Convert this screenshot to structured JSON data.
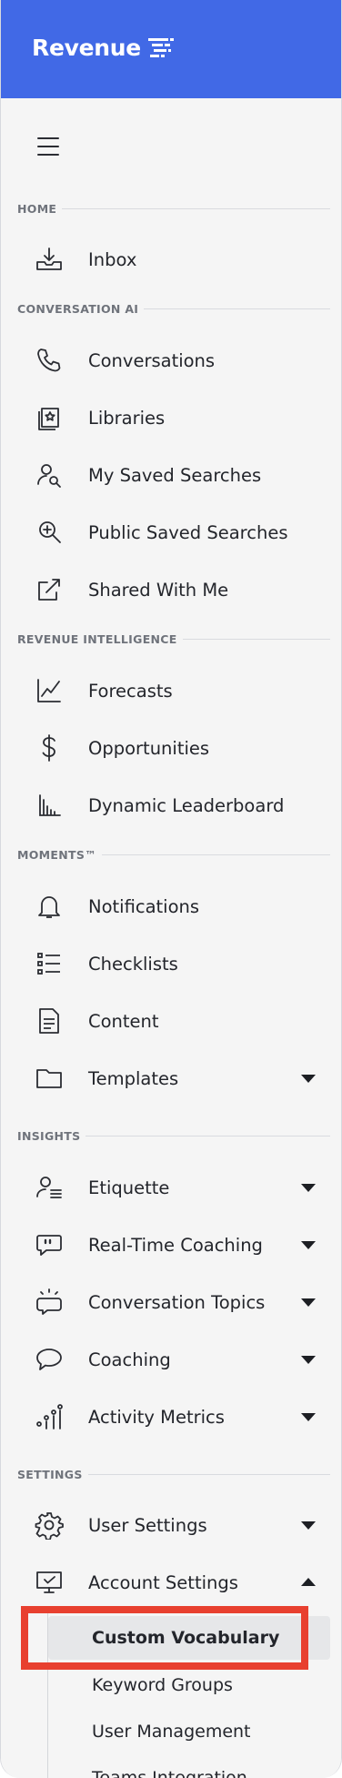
{
  "brand": {
    "name": "Revenue",
    "header_color": "#4169e6",
    "highlight_color": "#e8402f"
  },
  "menu_toggle": {
    "icon": "hamburger-icon"
  },
  "sections": {
    "home": "HOME",
    "conversation_ai": "CONVERSATION AI",
    "revenue_intelligence": "REVENUE INTELLIGENCE",
    "moments": "MOMENTS™",
    "insights": "INSIGHTS",
    "settings": "SETTINGS"
  },
  "items": {
    "inbox": "Inbox",
    "conversations": "Conversations",
    "libraries": "Libraries",
    "my_saved_searches": "My Saved Searches",
    "public_saved_searches": "Public Saved Searches",
    "shared_with_me": "Shared With Me",
    "forecasts": "Forecasts",
    "opportunities": "Opportunities",
    "dynamic_leaderboard": "Dynamic Leaderboard",
    "notifications": "Notifications",
    "checklists": "Checklists",
    "content": "Content",
    "templates": "Templates",
    "etiquette": "Etiquette",
    "real_time_coaching": "Real-Time Coaching",
    "conversation_topics": "Conversation Topics",
    "coaching": "Coaching",
    "activity_metrics": "Activity Metrics",
    "user_settings": "User Settings",
    "account_settings": "Account Settings"
  },
  "account_settings_sub": {
    "custom_vocabulary": "Custom Vocabulary",
    "keyword_groups": "Keyword Groups",
    "user_management": "User Management",
    "teams_integration": "Teams Integration"
  }
}
